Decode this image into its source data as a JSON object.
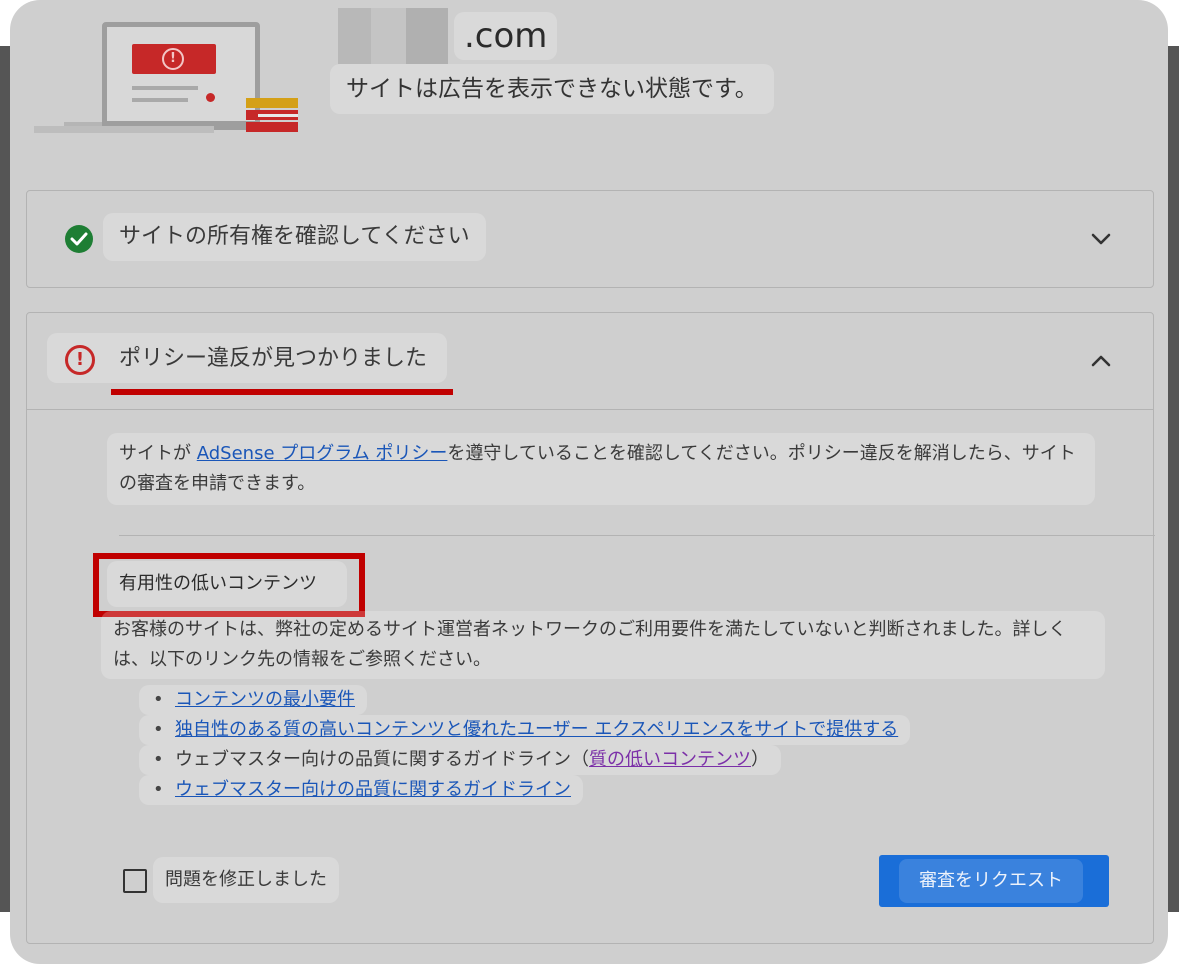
{
  "header": {
    "domain_suffix": ".com",
    "status_message": "サイトは広告を表示できない状態です。"
  },
  "panels": {
    "ownership": {
      "title": "サイトの所有権を確認してください",
      "status": "complete"
    },
    "policy": {
      "title": "ポリシー違反が見つかりました",
      "status": "error",
      "description_pre": "サイトが ",
      "policy_link": "AdSense プログラム ポリシー",
      "description_post": "を遵守していることを確認してください。ポリシー違反を解消したら、サイトの審査を申請できます。",
      "issue": {
        "title": "有用性の低いコンテンツ",
        "description": "お客様のサイトは、弊社の定めるサイト運営者ネットワークのご利用要件を満たしていないと判断されました。詳しくは、以下のリンク先の情報をご参照ください。",
        "links": [
          {
            "text": "コンテンツの最小要件"
          },
          {
            "text": "独自性のある質の高いコンテンツと優れたユーザー エクスペリエンスをサイトで提供する"
          },
          {
            "prefix": "ウェブマスター向けの品質に関するガイドライン（",
            "text": "質の低いコンテンツ",
            "suffix": "）"
          },
          {
            "text": "ウェブマスター向けの品質に関するガイドライン"
          }
        ]
      },
      "checkbox_label": "問題を修正しました",
      "checkbox_checked": false,
      "request_button": "審査をリクエスト"
    }
  },
  "colors": {
    "accent_blue": "#1a6ed8",
    "error_red": "#c62828",
    "success_green": "#1e7e34",
    "link": "#1a56b8",
    "visited_link": "#7b2fa8",
    "annotation_red": "#c00000"
  },
  "icons": {
    "ownership_status": "check-circle-icon",
    "policy_status": "error-circle-icon",
    "collapse": "chevron-down-icon",
    "expand": "chevron-up-icon"
  }
}
